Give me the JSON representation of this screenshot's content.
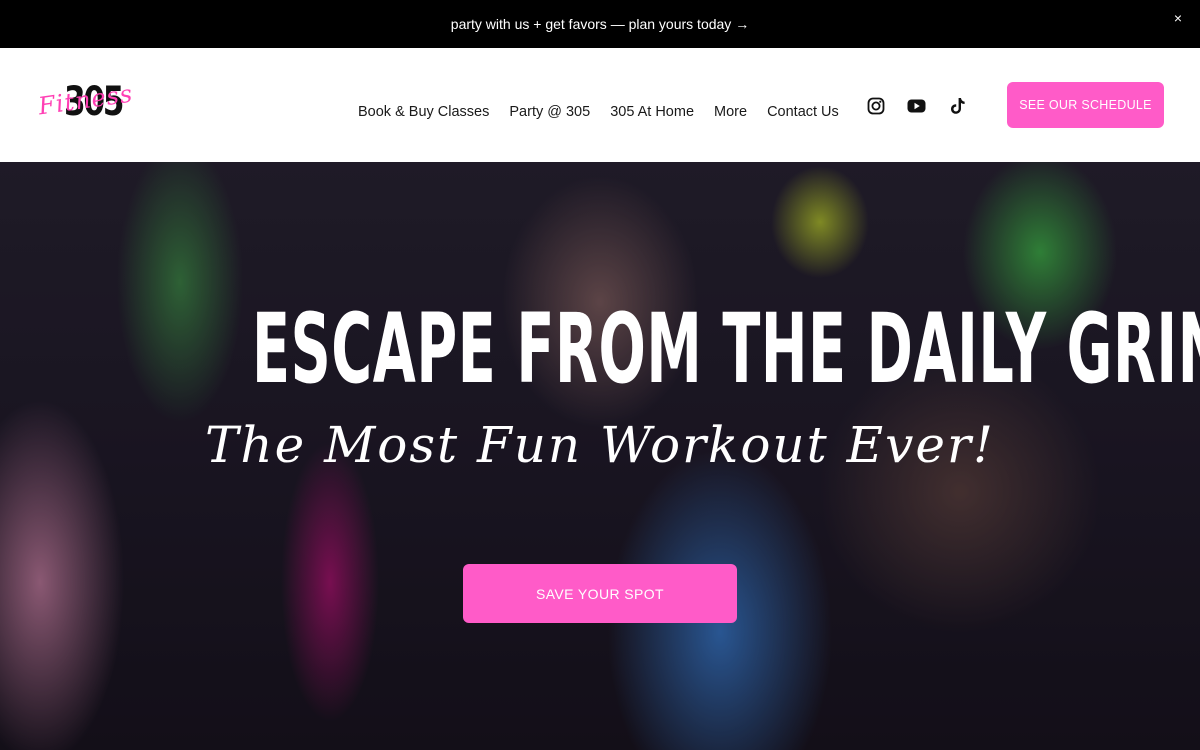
{
  "announcement": {
    "text": "party with us + get favors — plan yours today →",
    "close_label": "×"
  },
  "header": {
    "logo": {
      "number": "305",
      "script": "Fitness"
    },
    "nav": [
      {
        "label": "Book & Buy Classes"
      },
      {
        "label": "Party @ 305"
      },
      {
        "label": "305 At Home"
      },
      {
        "label": "More"
      },
      {
        "label": "Contact Us"
      }
    ],
    "socials": [
      {
        "icon": "instagram-icon"
      },
      {
        "icon": "youtube-icon"
      },
      {
        "icon": "tiktok-icon"
      }
    ],
    "cta_label": "SEE OUR SCHEDULE"
  },
  "hero": {
    "headline": "ESCAPE FROM THE DAILY GRIND",
    "subheadline": "The Most Fun Workout Ever!",
    "cta_label": "SAVE YOUR SPOT"
  },
  "colors": {
    "accent": "#ff5bc8",
    "announcement_bg": "#000000"
  }
}
